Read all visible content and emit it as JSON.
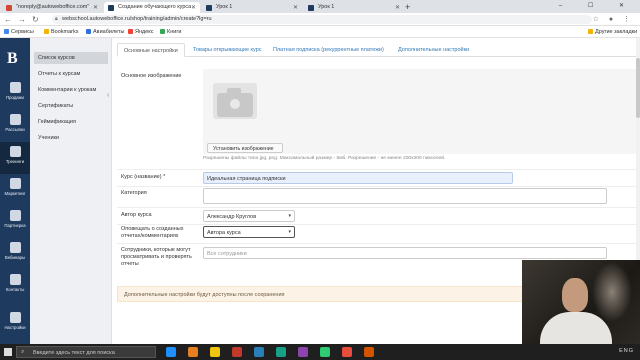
{
  "browser": {
    "tabs": [
      {
        "title": "\"noreply@autoweboffice.com\"",
        "favicon_color": "#d44638",
        "active": false
      },
      {
        "title": "Создание обучающего курса",
        "favicon_color": "#1e3a5f",
        "active": true
      },
      {
        "title": "Урок 1",
        "favicon_color": "#1e3a5f",
        "active": false
      },
      {
        "title": "Урок 1",
        "favicon_color": "#1e3a5f",
        "active": false
      }
    ],
    "new_tab_label": "+",
    "window_controls": "– ☐ ✕",
    "url": "webschool.autoweboffice.ru/shop/training/admin/create?lg=ru",
    "bookmarks": [
      {
        "label": "Сервисы",
        "color": "#4285f4"
      },
      {
        "label": "Bookmarks",
        "color": "#f4b400"
      },
      {
        "label": "Авиабилеты",
        "color": "#2f6fde"
      },
      {
        "label": "Яндекс",
        "color": "#f44336"
      },
      {
        "label": "Книги",
        "color": "#34a853"
      }
    ],
    "other_bookmarks": "Другие закладки"
  },
  "leftnav": {
    "logo": "B",
    "items": [
      {
        "label": "Продажи",
        "icon": "cart-icon"
      },
      {
        "label": "Рассылки",
        "icon": "send-icon"
      },
      {
        "label": "Тренинги",
        "icon": "graduation-icon"
      },
      {
        "label": "Маркетинг",
        "icon": "chart-icon"
      },
      {
        "label": "Партнерка",
        "icon": "network-icon"
      },
      {
        "label": "Вебинары",
        "icon": "webinar-icon"
      },
      {
        "label": "Контакты",
        "icon": "contacts-icon"
      },
      {
        "label": "Настройки",
        "icon": "gear-icon"
      }
    ],
    "active_index": 2
  },
  "subnav": {
    "items": [
      "Список курсов",
      "Отчеты к курсам",
      "Комментарии к урокам",
      "Сертификаты",
      "Геймификация",
      "Ученики"
    ],
    "active_index": 0,
    "collapse_glyph": "‹"
  },
  "main": {
    "tabs": [
      "Основные настройки",
      "Товары открывающие курс",
      "Платная подписка (рекуррентные платежи)",
      "Дополнительные настройки"
    ],
    "active_tab": 0,
    "image": {
      "label": "Основное изображение",
      "upload_button": "Установить изображение",
      "hint": "Разрешены файлы типа jpg, png. Максимальный размер - 5мб. Разрешение - не менее 200х200 пикселей."
    },
    "fields": {
      "course_name_label": "Курс (название) *",
      "course_name_value": "Идеальная страница подписки",
      "category_label": "Категория",
      "category_value": "",
      "author_label": "Автор курса",
      "author_value": "Александр Круглов",
      "notify_label": "Оповещать о созданных отчетах/комментариях",
      "notify_value": "Автора курса",
      "staff_label": "Сотрудники, которые могут просматривать и проверять отчеты",
      "staff_placeholder": "Все сотрудники"
    },
    "notice": "Дополнительные настройки будут доступны после сохранения"
  },
  "taskbar": {
    "search_placeholder": "Введите здесь текст для поиска",
    "tray_lang": "ENG",
    "icons": [
      "#1e90ff",
      "#e67e22",
      "#f1c40f",
      "#c0392b",
      "#2980b9",
      "#16a085",
      "#8e44ad",
      "#2ecc71",
      "#e74c3c",
      "#d35400"
    ]
  }
}
